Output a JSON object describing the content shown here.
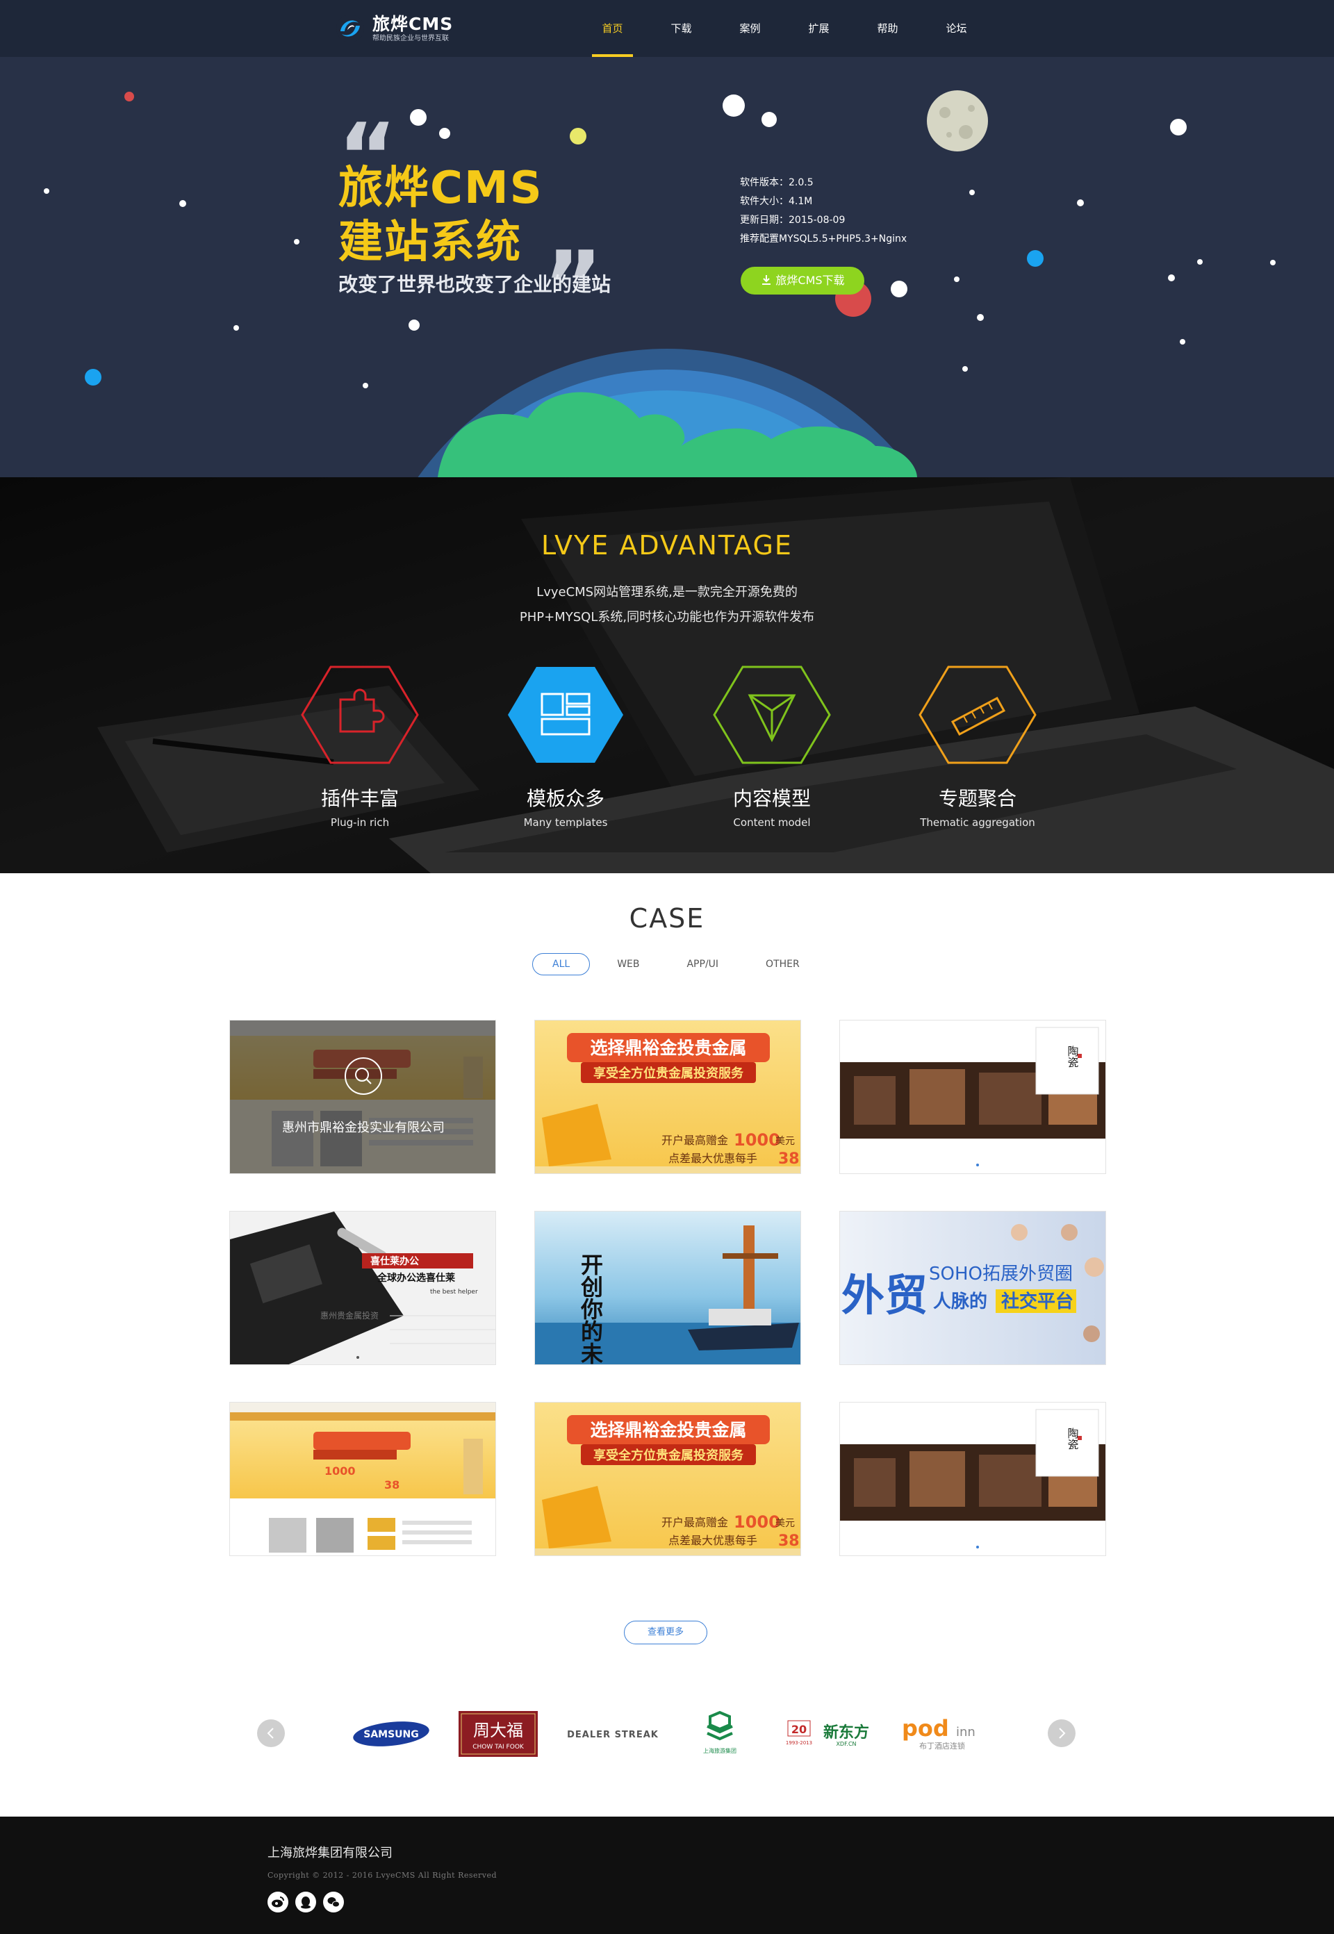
{
  "header": {
    "logo_title": "旅烨CMS",
    "logo_sub": "帮助民族企业与世界互联",
    "nav": [
      "首页",
      "下载",
      "案例",
      "扩展",
      "帮助",
      "论坛"
    ],
    "active_nav": "首页"
  },
  "hero": {
    "slogan_line1": "旅烨CMS",
    "slogan_line2": "建站系统",
    "slogan_sub": "改变了世界也改变了企业的建站",
    "info": [
      "软件版本：2.0.5",
      "软件大小：4.1M",
      "更新日期：2015-08-09",
      "推荐配置MYSQL5.5+PHP5.3+Nginx"
    ],
    "download_label": "旅烨CMS下载"
  },
  "advantage": {
    "title": "LVYE ADVANTAGE",
    "desc_line1": "LvyeCMS网站管理系统,是一款完全开源免费的",
    "desc_line2": "PHP+MYSQL系统,同时核心功能也作为开源软件发布",
    "features": [
      {
        "cn": "插件丰富",
        "en": "Plug-in rich",
        "icon": "puzzle-icon",
        "color": "#d8232a"
      },
      {
        "cn": "模板众多",
        "en": "Many templates",
        "icon": "template-icon",
        "color": "#1aa3f0"
      },
      {
        "cn": "内容模型",
        "en": "Content model",
        "icon": "triangle-icon",
        "color": "#7fc31c"
      },
      {
        "cn": "专题聚合",
        "en": "Thematic aggregation",
        "icon": "ruler-icon",
        "color": "#f0a01a"
      }
    ]
  },
  "cases": {
    "title": "CASE",
    "filters": [
      "ALL",
      "WEB",
      "APP/UI",
      "OTHER"
    ],
    "active_filter": "ALL",
    "hover_caption": "惠州市鼎裕金投实业有限公司",
    "items": [
      {
        "kind": "gold-site"
      },
      {
        "kind": "gold-banner",
        "banner_line1": "选择鼎裕金投贵金属",
        "banner_line2": "享受全方位贵金属投资服务",
        "offer1": "开户最高赠金",
        "offer1_num": "1000",
        "offer1_unit": "美元",
        "offer2": "点差最大优惠每手",
        "offer2_num": "38"
      },
      {
        "kind": "ceramic",
        "label": "陶瓷"
      },
      {
        "kind": "office",
        "tag": "喜仕莱办公",
        "headline": "全球办公选喜仕莱",
        "helper": "the best helper",
        "watermark": "惠州贵金属投资"
      },
      {
        "kind": "ocean",
        "calligraphy": "开创你的未来"
      },
      {
        "kind": "trade",
        "big": "外贸",
        "line1": "SOHO拓展外贸圈",
        "line2_a": "人脉的",
        "line2_b": "社交平台"
      },
      {
        "kind": "gold-site"
      },
      {
        "kind": "gold-banner",
        "banner_line1": "选择鼎裕金投贵金属",
        "banner_line2": "享受全方位贵金属投资服务",
        "offer1": "开户最高赠金",
        "offer1_num": "1000",
        "offer1_unit": "美元",
        "offer2": "点差最大优惠每手",
        "offer2_num": "38"
      },
      {
        "kind": "ceramic",
        "label": "陶瓷"
      }
    ],
    "more_label": "查看更多"
  },
  "partners": {
    "samsung": "SAMSUNG",
    "chowtaifook_cn": "周大福",
    "chowtaifook_en": "CHOW TAI FOOK",
    "dealer": "DEALER STREAK",
    "shanghai": "上海旅游集团",
    "xindongfang": "新东方",
    "xdf_years": "1993-2013",
    "xdf_num": "20",
    "xdf_url": "XDF.CN",
    "pod": "pod",
    "pod_inn": "inn",
    "pod_sub": "布丁酒店连锁"
  },
  "footer": {
    "company": "上海旅烨集团有限公司",
    "copyright": "Copyright © 2012 - 2016 LvyeCMS All Right Reserved"
  },
  "colors": {
    "header_bg": "#1e2739",
    "hero_bg": "#283147",
    "accent_yellow": "#f5c918",
    "download_green": "#8ed41f",
    "link_blue": "#3c7fd6",
    "footer_bg": "#101010"
  }
}
